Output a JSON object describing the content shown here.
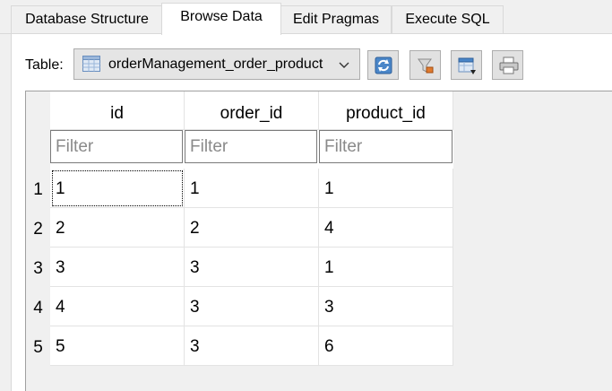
{
  "tabs": [
    {
      "label": "Database Structure",
      "active": false
    },
    {
      "label": "Browse Data",
      "active": true
    },
    {
      "label": "Edit Pragmas",
      "active": false
    },
    {
      "label": "Execute SQL",
      "active": false
    }
  ],
  "toolbar": {
    "table_label": "Table:",
    "selected_table": "orderManagement_order_product",
    "buttons": [
      "refresh-icon",
      "clear-filters-icon",
      "save-table-icon",
      "print-icon"
    ]
  },
  "grid": {
    "columns": [
      "id",
      "order_id",
      "product_id"
    ],
    "filter_placeholder": "Filter",
    "rows": [
      {
        "num": "1",
        "cells": [
          "1",
          "1",
          "1"
        ]
      },
      {
        "num": "2",
        "cells": [
          "2",
          "2",
          "4"
        ]
      },
      {
        "num": "3",
        "cells": [
          "3",
          "3",
          "1"
        ]
      },
      {
        "num": "4",
        "cells": [
          "4",
          "3",
          "3"
        ]
      },
      {
        "num": "5",
        "cells": [
          "5",
          "3",
          "6"
        ]
      }
    ]
  }
}
